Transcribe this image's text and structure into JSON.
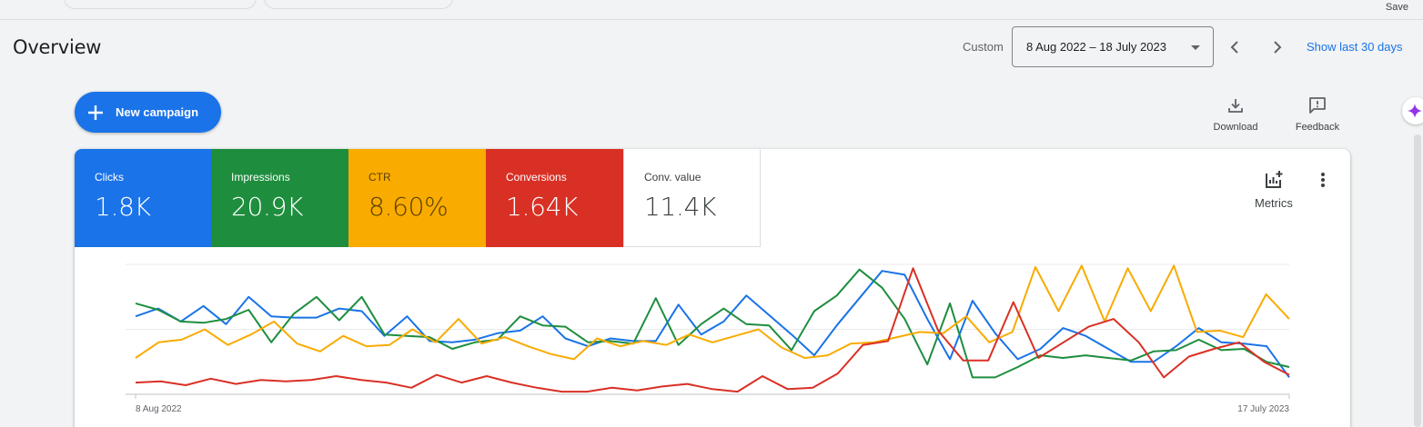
{
  "header": {
    "save_label": "Save",
    "title": "Overview",
    "date_range_label": "Custom",
    "date_range_value": "8 Aug 2022 – 18 July 2023",
    "show_last_label": "Show last 30 days"
  },
  "actions": {
    "new_campaign_label": "New campaign",
    "download_label": "Download",
    "feedback_label": "Feedback",
    "metrics_label": "Metrics"
  },
  "metric_tiles": [
    {
      "name": "Clicks",
      "value": "1.8K",
      "color": "#1a73e8"
    },
    {
      "name": "Impressions",
      "value": "20.9K",
      "color": "#1e8e3e"
    },
    {
      "name": "CTR",
      "value": "8.60%",
      "color": "#f9ab00"
    },
    {
      "name": "Conversions",
      "value": "1.64K",
      "color": "#d93025"
    },
    {
      "name": "Conv. value",
      "value": "11.4K",
      "color": "#ffffff"
    }
  ],
  "icons": {
    "plus": "plus-icon",
    "download": "download-icon",
    "feedback": "feedback-icon",
    "metrics": "metrics-icon",
    "more": "more-vert-icon",
    "prev": "chevron-left-icon",
    "next": "chevron-right-icon",
    "sparkle": "sparkle-icon"
  },
  "chart_data": {
    "type": "line",
    "x_start_label": "8 Aug 2022",
    "x_end_label": "17 July 2023",
    "grid": true,
    "series": [
      {
        "color": "#1a73e8",
        "values": [
          60,
          66,
          56,
          68,
          54,
          75,
          60,
          59,
          59,
          66,
          64,
          45,
          60,
          41,
          40,
          42,
          47,
          49,
          60,
          43,
          37,
          43,
          41,
          41,
          69,
          46,
          56,
          76,
          61,
          46,
          30,
          53,
          74,
          95,
          92,
          58,
          27,
          72,
          47,
          27,
          35,
          51,
          45,
          35,
          25,
          25,
          37,
          51,
          40,
          39,
          37,
          13
        ]
      },
      {
        "color": "#1e8e3e",
        "values": [
          70,
          65,
          56,
          55,
          58,
          65,
          40,
          62,
          75,
          57,
          75,
          46,
          45,
          44,
          35,
          40,
          42,
          60,
          53,
          52,
          40,
          41,
          39,
          74,
          38,
          54,
          66,
          54,
          53,
          34,
          64,
          76,
          96,
          82,
          58,
          23,
          70,
          13,
          13,
          21,
          30,
          28,
          30,
          28,
          26,
          33,
          34,
          42,
          34,
          35,
          25,
          21
        ]
      },
      {
        "color": "#f9ab00",
        "values": [
          28,
          40,
          42,
          50,
          38,
          46,
          56,
          39,
          33,
          45,
          37,
          38,
          50,
          40,
          58,
          39,
          44,
          37,
          31,
          27,
          43,
          37,
          41,
          38,
          46,
          40,
          45,
          50,
          36,
          28,
          30,
          39,
          40,
          44,
          48,
          47,
          60,
          40,
          48,
          98,
          64,
          99,
          56,
          97,
          64,
          99,
          48,
          49,
          44,
          77,
          58
        ]
      },
      {
        "color": "#d93025",
        "values": [
          9,
          10,
          7,
          12,
          8,
          11,
          10,
          11,
          14,
          11,
          9,
          5,
          15,
          9,
          14,
          9,
          5,
          2,
          2,
          5,
          3,
          6,
          8,
          4,
          2,
          14,
          4,
          5,
          16,
          38,
          41,
          97,
          49,
          26,
          26,
          71,
          28,
          40,
          52,
          58,
          40,
          13,
          29,
          35,
          40,
          25,
          15
        ]
      }
    ]
  }
}
